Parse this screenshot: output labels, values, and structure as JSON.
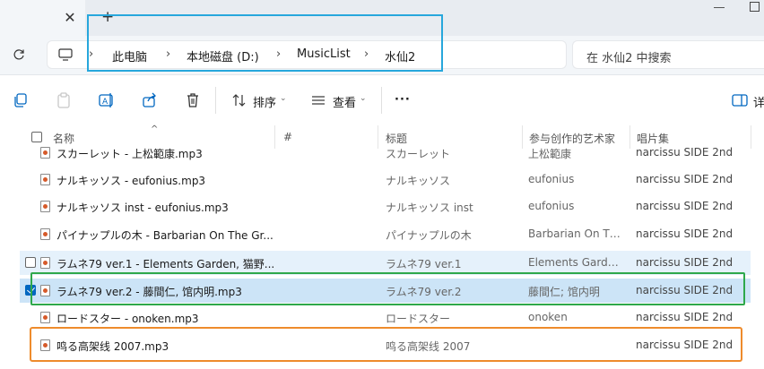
{
  "titlebar": {
    "close_glyph": "✕",
    "new_tab_glyph": "+"
  },
  "address": {
    "crumbs": [
      "此电脑",
      "本地磁盘 (D:)",
      "MusicList",
      "水仙2"
    ],
    "separator": "›",
    "search_placeholder": "在 水仙2 中搜索"
  },
  "toolbar": {
    "sort_label": "排序",
    "view_label": "查看",
    "more_label": "···",
    "details_label": "详"
  },
  "columns": {
    "name": "名称",
    "number": "#",
    "title": "标题",
    "artist": "参与创作的艺术家",
    "album": "唱片集"
  },
  "rows": [
    {
      "name": "スカーレット - 上松範康.mp3",
      "title": "スカーレット",
      "artist": "上松範康",
      "album": "narcissu SIDE 2nd",
      "state": "normal"
    },
    {
      "name": "ナルキッソス - eufonius.mp3",
      "title": "ナルキッソス",
      "artist": "eufonius",
      "album": "narcissu SIDE 2nd",
      "state": "normal"
    },
    {
      "name": "ナルキッソス inst - eufonius.mp3",
      "title": "ナルキッソス inst",
      "artist": "eufonius",
      "album": "narcissu SIDE 2nd",
      "state": "normal"
    },
    {
      "name": "パイナップルの木 - Barbarian On The Gr...",
      "title": "パイナップルの木",
      "artist": "Barbarian On Th...",
      "album": "narcissu SIDE 2nd",
      "state": "normal"
    },
    {
      "name": "ラムネ79 ver.1 - Elements Garden, 猫野...",
      "title": "ラムネ79 ver.1",
      "artist": "Elements Garde...",
      "album": "narcissu SIDE 2nd",
      "state": "hover"
    },
    {
      "name": "ラムネ79 ver.2 - 藤間仁, 馆内明.mp3",
      "title": "ラムネ79 ver.2",
      "artist": "藤間仁; 馆内明",
      "album": "narcissu SIDE 2nd",
      "state": "selected"
    },
    {
      "name": "ロードスター - onoken.mp3",
      "title": "ロードスター",
      "artist": "onoken",
      "album": "narcissu SIDE 2nd",
      "state": "normal"
    },
    {
      "name": "鸣る高架线 2007.mp3",
      "title": "鸣る高架线 2007",
      "artist": "",
      "album": "narcissu SIDE 2nd",
      "state": "normal"
    }
  ],
  "colors": {
    "selected_bg": "#cce4f7",
    "hover_bg": "#e5f1fb",
    "annotation_blue": "#27a7dc",
    "annotation_green": "#2ea84b",
    "annotation_orange": "#ee8b2c"
  }
}
